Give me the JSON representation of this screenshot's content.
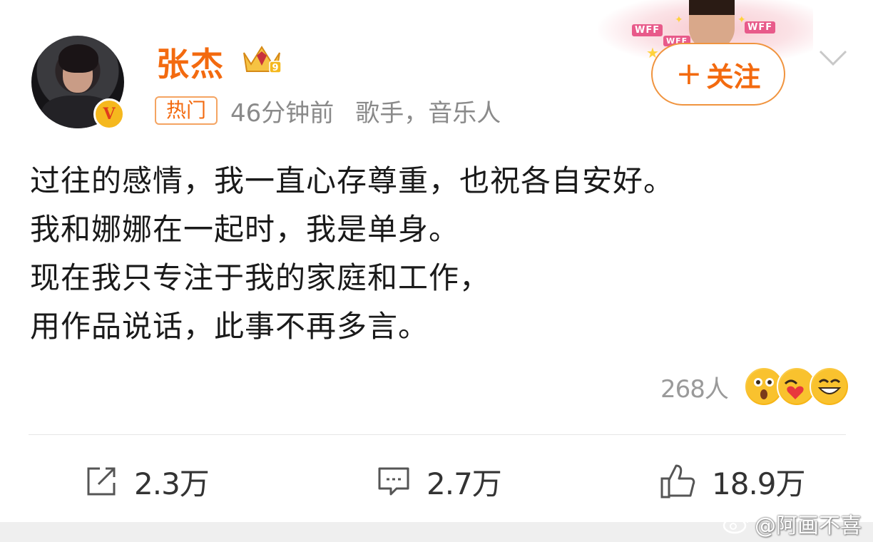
{
  "post": {
    "author": {
      "name": "张杰",
      "verified_mark": "V",
      "level_badge": "9"
    },
    "meta": {
      "tag": "热门",
      "time": "46分钟前",
      "description": "歌手，音乐人"
    },
    "follow_button": {
      "icon": "plus-icon",
      "label": "关注"
    },
    "content_lines": [
      "过往的感情，我一直心存尊重，也祝各自安好。",
      "我和娜娜在一起时，我是单身。",
      "现在我只专注于我的家庭和工作，",
      "用作品说话，此事不再多言。"
    ],
    "reactions": {
      "count": "268人",
      "emojis": [
        "surprised-emoji",
        "heart-face-emoji",
        "grin-emoji"
      ]
    },
    "actions": {
      "share": "2.3万",
      "comment": "2.7万",
      "like": "18.9万"
    },
    "banner": {
      "tags": [
        "WFF",
        "WFF",
        "WFF"
      ]
    }
  },
  "watermark": "@阿画不喜",
  "colors": {
    "accent": "#f36a0f",
    "follow_border": "#f0943f",
    "meta_gray": "#8a8a8a",
    "divider": "#e6e6e6"
  }
}
